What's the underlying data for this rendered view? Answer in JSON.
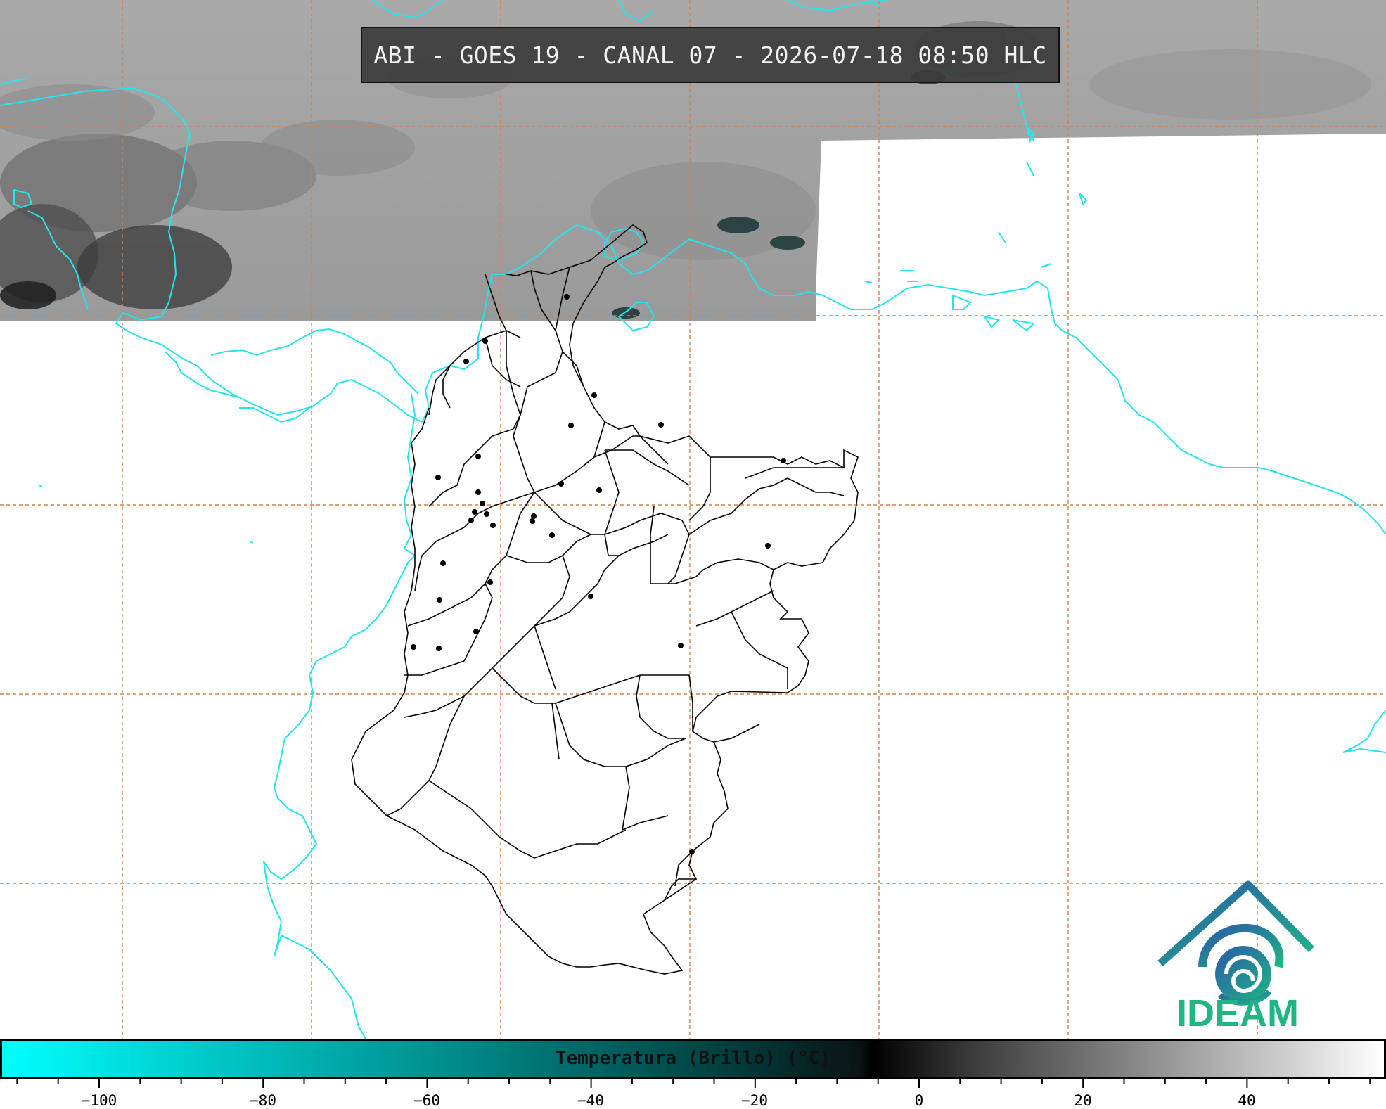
{
  "title": "ABI - GOES 19 - CANAL 07 - 2026-07-18 08:50 HLC",
  "colorbar": {
    "label": "Temperatura (Brillo) (°C)",
    "ticks": [
      "−100",
      "−80",
      "−60",
      "−40",
      "−20",
      "0",
      "20",
      "40"
    ],
    "colors": [
      "#00ffff",
      "#008a8a",
      "#004848",
      "#000000",
      "#888888",
      "#ffffff"
    ]
  },
  "logo": {
    "text": "IDEAM",
    "icon": "ideam-logo-icon"
  },
  "colors": {
    "coastline": "#22e5ee",
    "grid": "#d2824a",
    "borders": "#000000"
  }
}
